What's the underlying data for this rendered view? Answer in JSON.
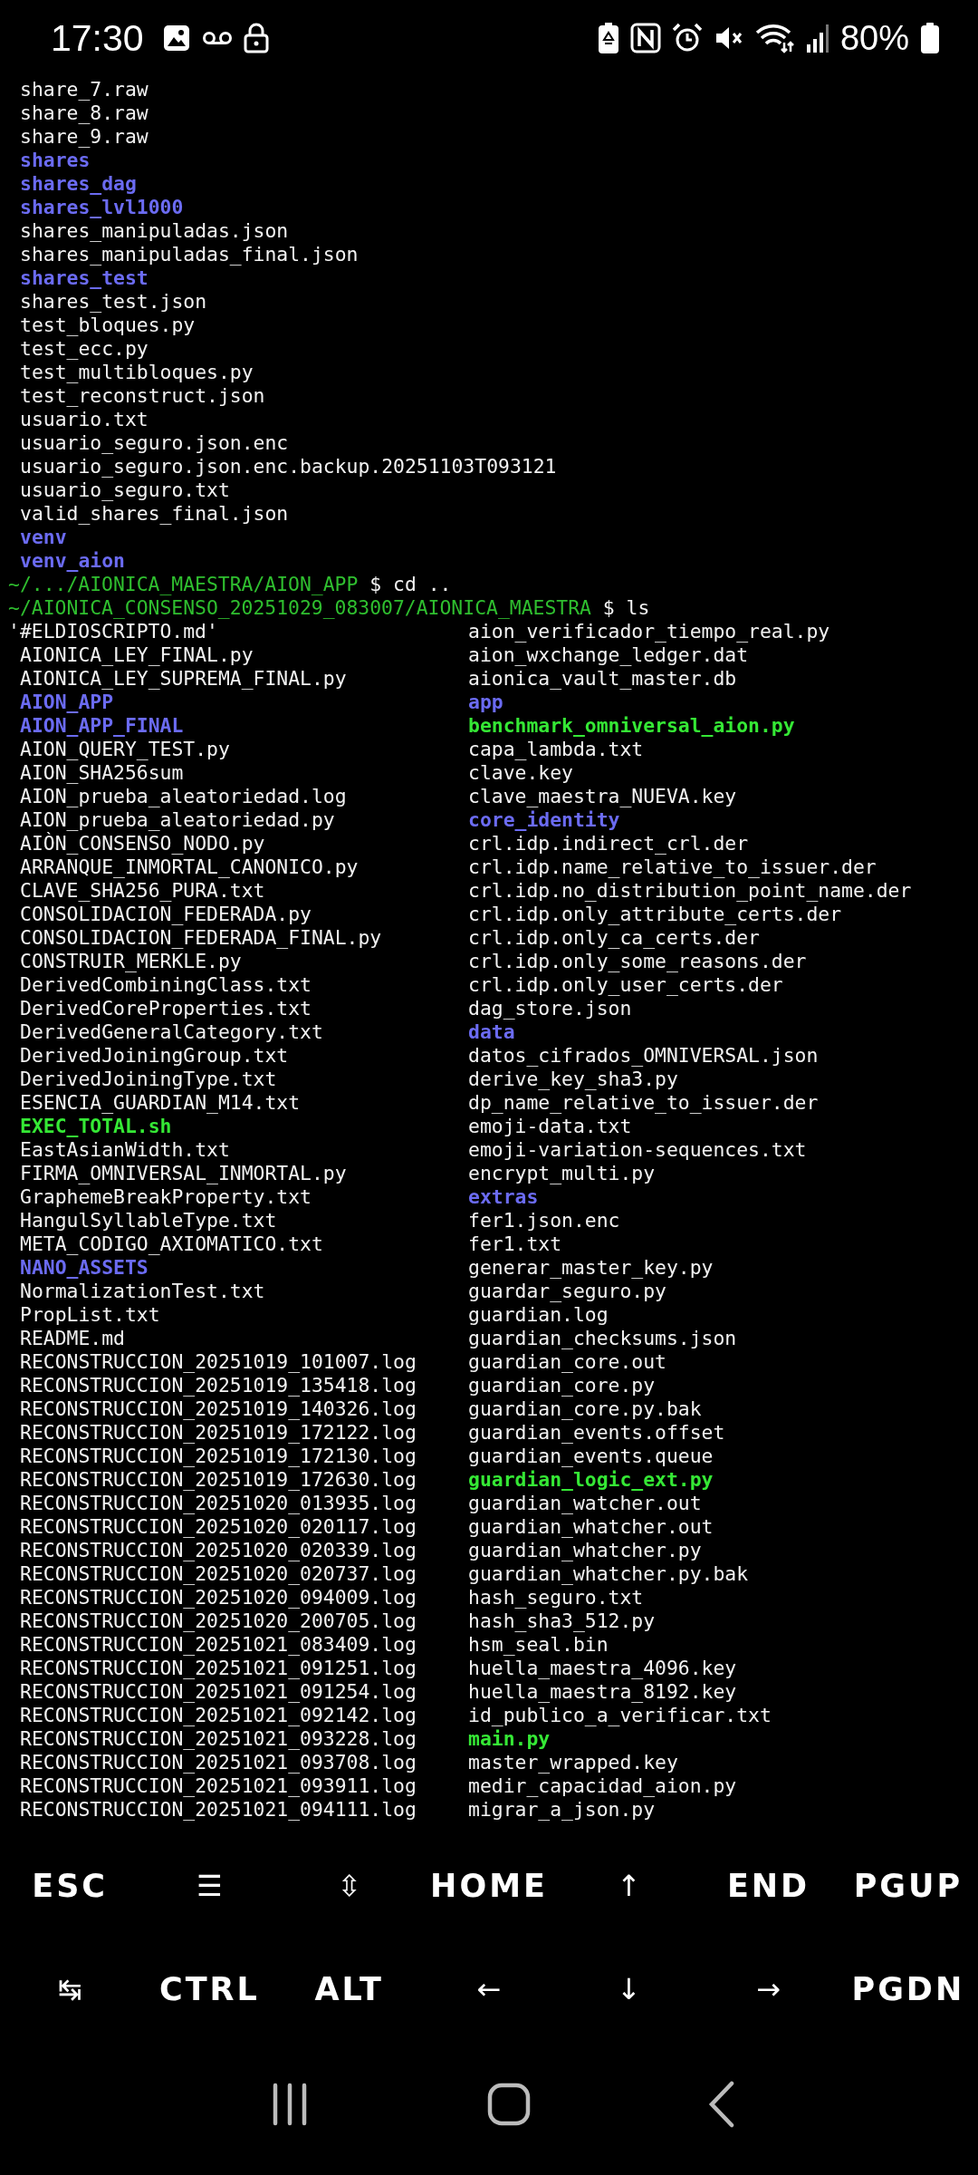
{
  "status_bar": {
    "time": "17:30",
    "battery_text": "80%"
  },
  "terminal": {
    "previous_output": [
      {
        "name": "share_7.raw",
        "kind": "file"
      },
      {
        "name": "share_8.raw",
        "kind": "file"
      },
      {
        "name": "share_9.raw",
        "kind": "file"
      },
      {
        "name": "shares",
        "kind": "directory"
      },
      {
        "name": "shares_dag",
        "kind": "directory"
      },
      {
        "name": "shares_lvl1000",
        "kind": "directory"
      },
      {
        "name": "shares_manipuladas.json",
        "kind": "file"
      },
      {
        "name": "shares_manipuladas_final.json",
        "kind": "file"
      },
      {
        "name": "shares_test",
        "kind": "directory"
      },
      {
        "name": "shares_test.json",
        "kind": "file"
      },
      {
        "name": "test_bloques.py",
        "kind": "file"
      },
      {
        "name": "test_ecc.py",
        "kind": "file"
      },
      {
        "name": "test_multibloques.py",
        "kind": "file"
      },
      {
        "name": "test_reconstruct.json",
        "kind": "file"
      },
      {
        "name": "usuario.txt",
        "kind": "file"
      },
      {
        "name": "usuario_seguro.json.enc",
        "kind": "file"
      },
      {
        "name": "usuario_seguro.json.enc.backup.20251103T093121",
        "kind": "file"
      },
      {
        "name": "usuario_seguro.txt",
        "kind": "file"
      },
      {
        "name": "valid_shares_final.json",
        "kind": "file"
      },
      {
        "name": "venv",
        "kind": "directory"
      },
      {
        "name": "venv_aion",
        "kind": "directory"
      }
    ],
    "prompts": [
      {
        "path": "~/.../AIONICA_MAESTRA/AION_APP",
        "symbol": "$",
        "command": "cd .."
      },
      {
        "path": "~/AIONICA_CONSENSO_20251029_083007/AIONICA_MAESTRA",
        "symbol": "$",
        "command": "ls"
      }
    ],
    "listing": [
      {
        "left": {
          "name": "'#ELDIOSCRIPTO.md'",
          "kind": "quoted"
        },
        "right": {
          "name": "aion_verificador_tiempo_real.py",
          "kind": "file"
        }
      },
      {
        "left": {
          "name": "AIONICA_LEY_FINAL.py",
          "kind": "file"
        },
        "right": {
          "name": "aion_wxchange_ledger.dat",
          "kind": "file"
        }
      },
      {
        "left": {
          "name": "AIONICA_LEY_SUPREMA_FINAL.py",
          "kind": "file"
        },
        "right": {
          "name": "aionica_vault_master.db",
          "kind": "file"
        }
      },
      {
        "left": {
          "name": "AION_APP",
          "kind": "directory"
        },
        "right": {
          "name": "app",
          "kind": "directory"
        }
      },
      {
        "left": {
          "name": "AION_APP_FINAL",
          "kind": "directory"
        },
        "right": {
          "name": "benchmark_omniversal_aion.py",
          "kind": "executable"
        }
      },
      {
        "left": {
          "name": "AION_QUERY_TEST.py",
          "kind": "file"
        },
        "right": {
          "name": "capa_lambda.txt",
          "kind": "file"
        }
      },
      {
        "left": {
          "name": "AION_SHA256sum",
          "kind": "file"
        },
        "right": {
          "name": "clave.key",
          "kind": "file"
        }
      },
      {
        "left": {
          "name": "AION_prueba_aleatoriedad.log",
          "kind": "file"
        },
        "right": {
          "name": "clave_maestra_NUEVA.key",
          "kind": "file"
        }
      },
      {
        "left": {
          "name": "AION_prueba_aleatoriedad.py",
          "kind": "file"
        },
        "right": {
          "name": "core_identity",
          "kind": "directory"
        }
      },
      {
        "left": {
          "name": "AIÒN_CONSENSO_NODO.py",
          "kind": "file"
        },
        "right": {
          "name": "crl.idp.indirect_crl.der",
          "kind": "file"
        }
      },
      {
        "left": {
          "name": "ARRANQUE_INMORTAL_CANONICO.py",
          "kind": "file"
        },
        "right": {
          "name": "crl.idp.name_relative_to_issuer.der",
          "kind": "file"
        }
      },
      {
        "left": {
          "name": "CLAVE_SHA256_PURA.txt",
          "kind": "file"
        },
        "right": {
          "name": "crl.idp.no_distribution_point_name.der",
          "kind": "file"
        }
      },
      {
        "left": {
          "name": "CONSOLIDACION_FEDERADA.py",
          "kind": "file"
        },
        "right": {
          "name": "crl.idp.only_attribute_certs.der",
          "kind": "file"
        }
      },
      {
        "left": {
          "name": "CONSOLIDACION_FEDERADA_FINAL.py",
          "kind": "file"
        },
        "right": {
          "name": "crl.idp.only_ca_certs.der",
          "kind": "file"
        }
      },
      {
        "left": {
          "name": "CONSTRUIR_MERKLE.py",
          "kind": "file"
        },
        "right": {
          "name": "crl.idp.only_some_reasons.der",
          "kind": "file"
        }
      },
      {
        "left": {
          "name": "DerivedCombiningClass.txt",
          "kind": "file"
        },
        "right": {
          "name": "crl.idp.only_user_certs.der",
          "kind": "file"
        }
      },
      {
        "left": {
          "name": "DerivedCoreProperties.txt",
          "kind": "file"
        },
        "right": {
          "name": "dag_store.json",
          "kind": "file"
        }
      },
      {
        "left": {
          "name": "DerivedGeneralCategory.txt",
          "kind": "file"
        },
        "right": {
          "name": "data",
          "kind": "directory"
        }
      },
      {
        "left": {
          "name": "DerivedJoiningGroup.txt",
          "kind": "file"
        },
        "right": {
          "name": "datos_cifrados_OMNIVERSAL.json",
          "kind": "file"
        }
      },
      {
        "left": {
          "name": "DerivedJoiningType.txt",
          "kind": "file"
        },
        "right": {
          "name": "derive_key_sha3.py",
          "kind": "file"
        }
      },
      {
        "left": {
          "name": "ESENCIA_GUARDIAN_M14.txt",
          "kind": "file"
        },
        "right": {
          "name": "dp_name_relative_to_issuer.der",
          "kind": "file"
        }
      },
      {
        "left": {
          "name": "EXEC_TOTAL.sh",
          "kind": "executable"
        },
        "right": {
          "name": "emoji-data.txt",
          "kind": "file"
        }
      },
      {
        "left": {
          "name": "EastAsianWidth.txt",
          "kind": "file"
        },
        "right": {
          "name": "emoji-variation-sequences.txt",
          "kind": "file"
        }
      },
      {
        "left": {
          "name": "FIRMA_OMNIVERSAL_INMORTAL.py",
          "kind": "file"
        },
        "right": {
          "name": "encrypt_multi.py",
          "kind": "file"
        }
      },
      {
        "left": {
          "name": "GraphemeBreakProperty.txt",
          "kind": "file"
        },
        "right": {
          "name": "extras",
          "kind": "directory"
        }
      },
      {
        "left": {
          "name": "HangulSyllableType.txt",
          "kind": "file"
        },
        "right": {
          "name": "fer1.json.enc",
          "kind": "file"
        }
      },
      {
        "left": {
          "name": "META_CODIGO_AXIOMATICO.txt",
          "kind": "file"
        },
        "right": {
          "name": "fer1.txt",
          "kind": "file"
        }
      },
      {
        "left": {
          "name": "NANO_ASSETS",
          "kind": "directory"
        },
        "right": {
          "name": "generar_master_key.py",
          "kind": "file"
        }
      },
      {
        "left": {
          "name": "NormalizationTest.txt",
          "kind": "file"
        },
        "right": {
          "name": "guardar_seguro.py",
          "kind": "file"
        }
      },
      {
        "left": {
          "name": "PropList.txt",
          "kind": "file"
        },
        "right": {
          "name": "guardian.log",
          "kind": "file"
        }
      },
      {
        "left": {
          "name": "README.md",
          "kind": "file"
        },
        "right": {
          "name": "guardian_checksums.json",
          "kind": "file"
        }
      },
      {
        "left": {
          "name": "RECONSTRUCCION_20251019_101007.log",
          "kind": "file"
        },
        "right": {
          "name": "guardian_core.out",
          "kind": "file"
        }
      },
      {
        "left": {
          "name": "RECONSTRUCCION_20251019_135418.log",
          "kind": "file"
        },
        "right": {
          "name": "guardian_core.py",
          "kind": "file"
        }
      },
      {
        "left": {
          "name": "RECONSTRUCCION_20251019_140326.log",
          "kind": "file"
        },
        "right": {
          "name": "guardian_core.py.bak",
          "kind": "file"
        }
      },
      {
        "left": {
          "name": "RECONSTRUCCION_20251019_172122.log",
          "kind": "file"
        },
        "right": {
          "name": "guardian_events.offset",
          "kind": "file"
        }
      },
      {
        "left": {
          "name": "RECONSTRUCCION_20251019_172130.log",
          "kind": "file"
        },
        "right": {
          "name": "guardian_events.queue",
          "kind": "file"
        }
      },
      {
        "left": {
          "name": "RECONSTRUCCION_20251019_172630.log",
          "kind": "file"
        },
        "right": {
          "name": "guardian_logic_ext.py",
          "kind": "executable"
        }
      },
      {
        "left": {
          "name": "RECONSTRUCCION_20251020_013935.log",
          "kind": "file"
        },
        "right": {
          "name": "guardian_watcher.out",
          "kind": "file"
        }
      },
      {
        "left": {
          "name": "RECONSTRUCCION_20251020_020117.log",
          "kind": "file"
        },
        "right": {
          "name": "guardian_whatcher.out",
          "kind": "file"
        }
      },
      {
        "left": {
          "name": "RECONSTRUCCION_20251020_020339.log",
          "kind": "file"
        },
        "right": {
          "name": "guardian_whatcher.py",
          "kind": "file"
        }
      },
      {
        "left": {
          "name": "RECONSTRUCCION_20251020_020737.log",
          "kind": "file"
        },
        "right": {
          "name": "guardian_whatcher.py.bak",
          "kind": "file"
        }
      },
      {
        "left": {
          "name": "RECONSTRUCCION_20251020_094009.log",
          "kind": "file"
        },
        "right": {
          "name": "hash_seguro.txt",
          "kind": "file"
        }
      },
      {
        "left": {
          "name": "RECONSTRUCCION_20251020_200705.log",
          "kind": "file"
        },
        "right": {
          "name": "hash_sha3_512.py",
          "kind": "file"
        }
      },
      {
        "left": {
          "name": "RECONSTRUCCION_20251021_083409.log",
          "kind": "file"
        },
        "right": {
          "name": "hsm_seal.bin",
          "kind": "file"
        }
      },
      {
        "left": {
          "name": "RECONSTRUCCION_20251021_091251.log",
          "kind": "file"
        },
        "right": {
          "name": "huella_maestra_4096.key",
          "kind": "file"
        }
      },
      {
        "left": {
          "name": "RECONSTRUCCION_20251021_091254.log",
          "kind": "file"
        },
        "right": {
          "name": "huella_maestra_8192.key",
          "kind": "file"
        }
      },
      {
        "left": {
          "name": "RECONSTRUCCION_20251021_092142.log",
          "kind": "file"
        },
        "right": {
          "name": "id_publico_a_verificar.txt",
          "kind": "file"
        }
      },
      {
        "left": {
          "name": "RECONSTRUCCION_20251021_093228.log",
          "kind": "file"
        },
        "right": {
          "name": "main.py",
          "kind": "executable"
        }
      },
      {
        "left": {
          "name": "RECONSTRUCCION_20251021_093708.log",
          "kind": "file"
        },
        "right": {
          "name": "master_wrapped.key",
          "kind": "file"
        }
      },
      {
        "left": {
          "name": "RECONSTRUCCION_20251021_093911.log",
          "kind": "file"
        },
        "right": {
          "name": "medir_capacidad_aion.py",
          "kind": "file"
        }
      },
      {
        "left": {
          "name": "RECONSTRUCCION_20251021_094111.log",
          "kind": "file"
        },
        "right": {
          "name": "migrar_a_json.py",
          "kind": "file"
        }
      }
    ]
  },
  "extra_keys": [
    [
      "ESC",
      "☰",
      "⇳",
      "HOME",
      "↑",
      "END",
      "PGUP"
    ],
    [
      "↹",
      "CTRL",
      "ALT",
      "←",
      "↓",
      "→",
      "PGDN"
    ]
  ]
}
